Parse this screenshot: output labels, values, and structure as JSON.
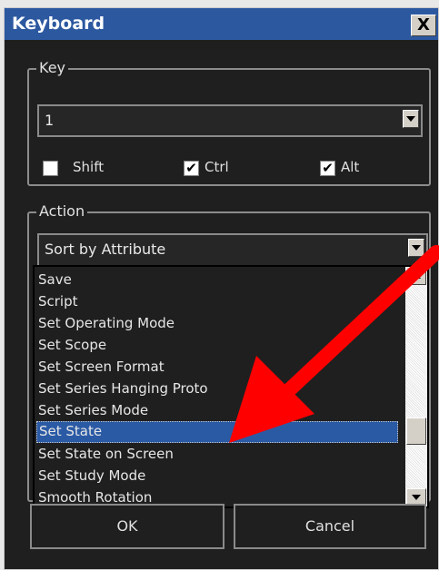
{
  "window": {
    "title": "Keyboard",
    "close_label": "X"
  },
  "key_group": {
    "label": "Key",
    "key_value": "1",
    "modifiers": [
      {
        "label": "Shift",
        "checked": false
      },
      {
        "label": "Ctrl",
        "checked": true
      },
      {
        "label": "Alt",
        "checked": true
      }
    ]
  },
  "action_group": {
    "label": "Action",
    "selected_value": "Sort by Attribute",
    "options": [
      "Save",
      "Script",
      "Set Operating Mode",
      "Set Scope",
      "Set Screen Format",
      "Set Series Hanging Proto",
      "Set Series Mode",
      "Set State",
      "Set State on Screen",
      "Set Study Mode",
      "Smooth Rotation"
    ],
    "highlighted_option": "Set State"
  },
  "buttons": {
    "ok": "OK",
    "cancel": "Cancel"
  },
  "colors": {
    "titlebar": "#2c58a0",
    "selection": "#2b5aa5",
    "annotation_arrow": "#ff0000"
  },
  "icons": {
    "close": "close-icon",
    "dropdown": "chevron-down-icon",
    "checkmark": "checkmark-icon"
  }
}
